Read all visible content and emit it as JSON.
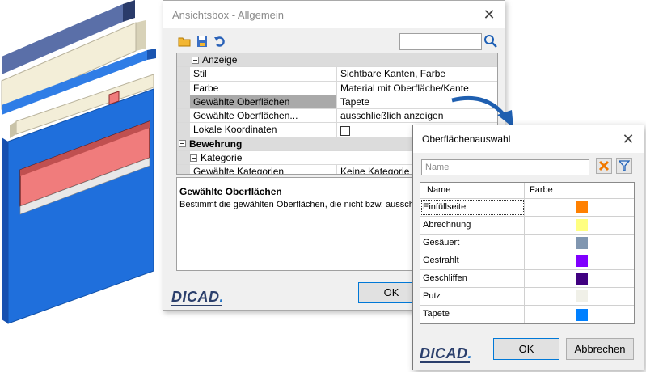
{
  "main_dialog": {
    "title": "Ansichtsbox - Allgemein",
    "properties": {
      "cat_anzeige": "Anzeige",
      "rows_anzeige": [
        {
          "name": "Stil",
          "value": "Sichtbare Kanten, Farbe"
        },
        {
          "name": "Farbe",
          "value": "Material mit Oberfläche/Kante"
        },
        {
          "name": "Gewählte Oberflächen",
          "value": "Tapete"
        },
        {
          "name": "Gewählte Oberflächen...",
          "value": "ausschließlich anzeigen"
        },
        {
          "name": "Lokale Koordinaten",
          "value": ""
        }
      ],
      "cat_bewehrung": "Bewehrung",
      "sub_kategorie": "Kategorie",
      "rows_kategorie": [
        {
          "name": "Gewählte Kategorien",
          "value": "Keine Kategorie gew"
        }
      ]
    },
    "description": {
      "title": "Gewählte Oberflächen",
      "text": "Bestimmt die gewählten Oberflächen, die nicht bzw. ausschließ werden können."
    },
    "logo": "DICAD",
    "ok_label": "OK"
  },
  "surface_dialog": {
    "title": "Oberflächenauswahl",
    "name_placeholder": "Name",
    "columns": {
      "name": "Name",
      "color": "Farbe"
    },
    "items": [
      {
        "name": "Einfüllseite",
        "color": "#ff8000"
      },
      {
        "name": "Abrechnung",
        "color": "#ffff80"
      },
      {
        "name": "Gesäuert",
        "color": "#8096b0"
      },
      {
        "name": "Gestrahlt",
        "color": "#8000ff"
      },
      {
        "name": "Geschliffen",
        "color": "#400080"
      },
      {
        "name": "Putz",
        "color": "#f0f0e8"
      },
      {
        "name": "Tapete",
        "color": "#0080ff"
      }
    ],
    "logo": "DICAD",
    "ok_label": "OK",
    "cancel_label": "Abbrechen"
  },
  "colors": {
    "model_blue": "#1f6fdc",
    "model_red": "#f07c7c",
    "model_beige": "#f3eed8",
    "arrow_blue": "#1f5fb0"
  }
}
